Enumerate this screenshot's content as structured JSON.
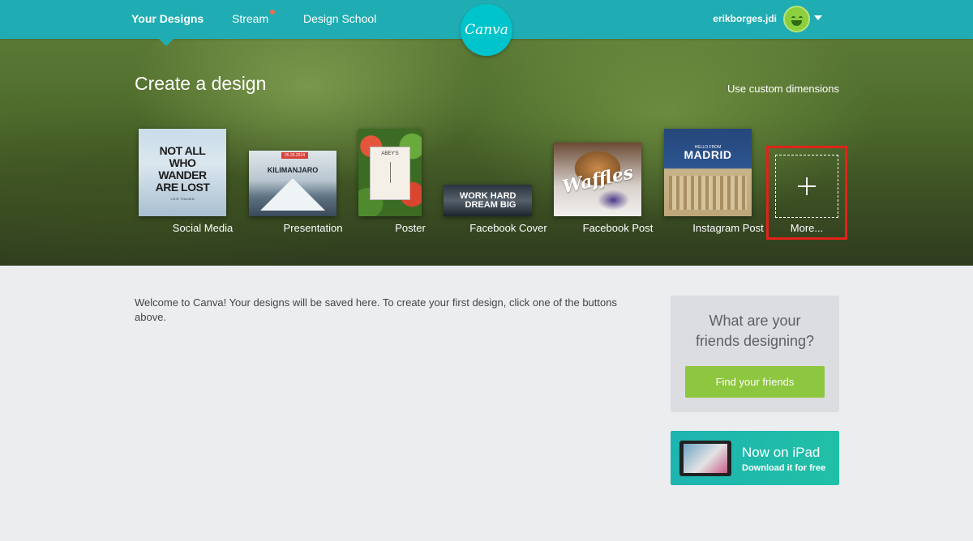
{
  "nav": {
    "items": [
      {
        "label": "Your Designs"
      },
      {
        "label": "Stream"
      },
      {
        "label": "Design School"
      }
    ],
    "logo_text": "Canva",
    "username": "erikborges.jdi"
  },
  "hero": {
    "title": "Create a design",
    "custom_dimensions": "Use custom dimensions",
    "design_types": [
      {
        "label": "Social Media",
        "thumb_text": "NOT ALL WHO WANDER ARE LOST",
        "thumb_sub": "J.R.R. TOLKIEN"
      },
      {
        "label": "Presentation",
        "thumb_tag": "05.26.2014",
        "thumb_text": "KILIMANJARO"
      },
      {
        "label": "Poster",
        "thumb_text": "ABEY'S"
      },
      {
        "label": "Facebook Cover",
        "thumb_text": "WORK HARD DREAM BIG"
      },
      {
        "label": "Facebook Post",
        "thumb_text": "Waffles"
      },
      {
        "label": "Instagram Post",
        "thumb_small": "HELLO FROM",
        "thumb_text": "MADRID"
      }
    ],
    "more_label": "More..."
  },
  "main": {
    "welcome_text": "Welcome to Canva! Your designs will be saved here. To create your first design, click one of the buttons above."
  },
  "sidebar": {
    "friends_question": "What are your friends designing?",
    "find_friends_label": "Find your friends",
    "ipad_title": "Now on iPad",
    "ipad_sub": "Download it for free"
  },
  "colors": {
    "topbar": "#1fadb3",
    "logo": "#00c4cc",
    "accent_green": "#8dc63f",
    "highlight_red": "#e2231a",
    "notification": "#f26b4a"
  }
}
